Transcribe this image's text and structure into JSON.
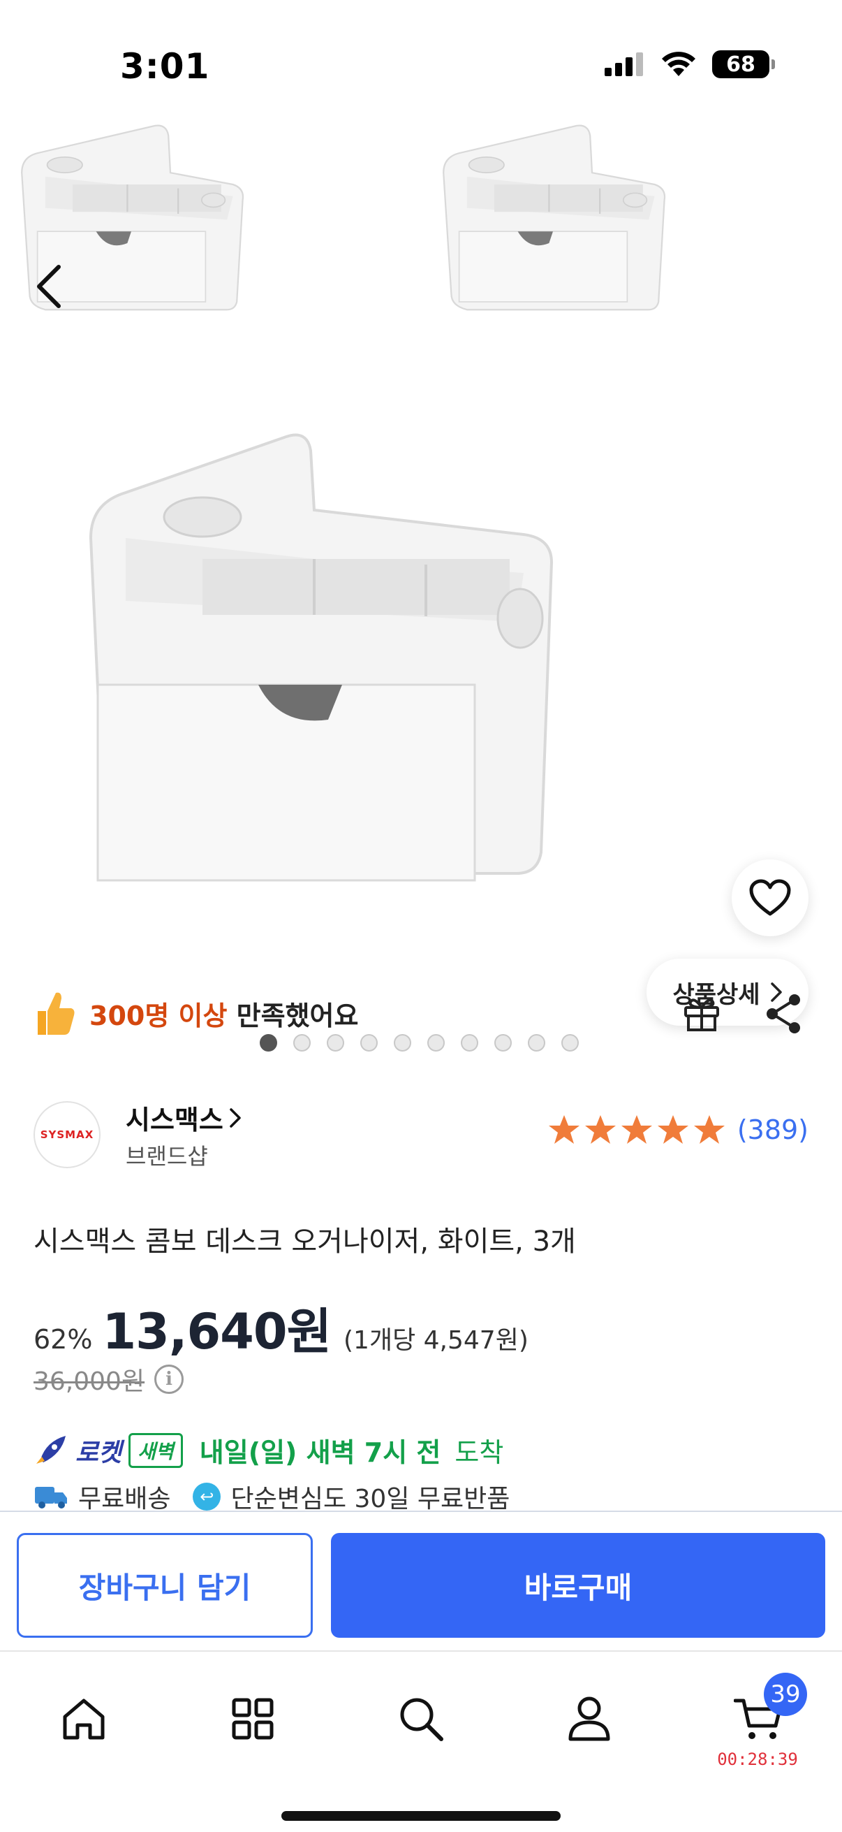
{
  "status_bar": {
    "time": "3:01",
    "battery": "68",
    "signal": "signal-icon",
    "wifi": "wifi-icon"
  },
  "gallery": {
    "slides_total": 10,
    "current_slide": 1,
    "detail_button_label": "상품상세",
    "icons": {
      "back": "chevron-left-icon",
      "wishlist": "heart-icon"
    }
  },
  "satisfaction": {
    "highlight": "300명 이상",
    "rest": "만족했어요",
    "icon": "thumbs-up-icon"
  },
  "actions": {
    "gift": "gift-icon",
    "share": "share-icon"
  },
  "brand": {
    "logo_text": "SYSMAX",
    "name": "시스맥스",
    "subtitle": "브랜드샵",
    "rating_stars": 5,
    "review_count": "(389)"
  },
  "product": {
    "title": "시스맥스 콤보 데스크 오거나이저, 화이트, 3개"
  },
  "price": {
    "discount": "62%",
    "current": "13,640원",
    "unit": "(1개당 4,547원)",
    "original": "36,000원"
  },
  "delivery": {
    "rocket_label": "로켓",
    "dawn_badge": "새벽",
    "arrival_strong": "내일(일) 새벽 7시 전",
    "arrival_rest": "도착",
    "free_shipping": "무료배송",
    "returns": "단순변심도 30일 무료반품"
  },
  "cta": {
    "cart_label": "장바구니 담기",
    "buy_label": "바로구매"
  },
  "tab_bar": {
    "items": [
      "home-icon",
      "category-icon",
      "search-icon",
      "profile-icon",
      "cart-icon"
    ],
    "cart_badge": "39",
    "cart_timer": "00:28:39"
  },
  "colors": {
    "accent": "#3466f5",
    "discount_accent": "#d4470e",
    "delivery": "#13a04a",
    "star": "#f07c3a"
  }
}
